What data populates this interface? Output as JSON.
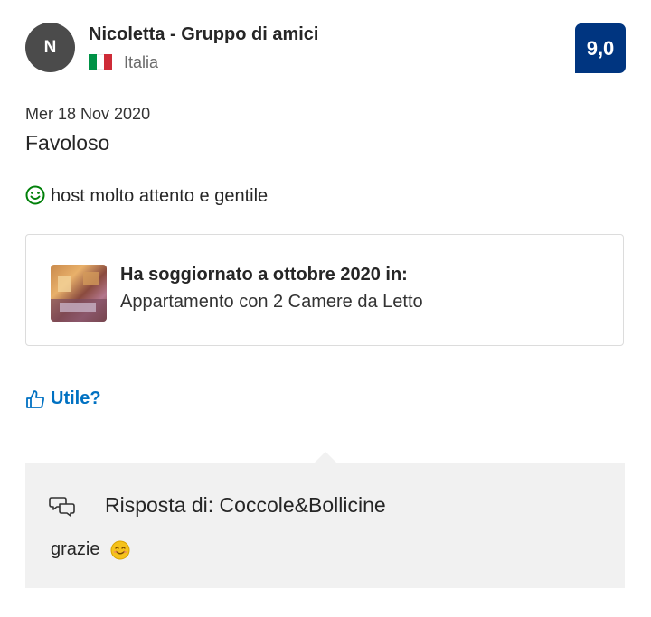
{
  "reviewer": {
    "initial": "N",
    "name": "Nicoletta - Gruppo di amici",
    "country": "Italia",
    "flag_colors": [
      "#009246",
      "#ffffff",
      "#ce2b37"
    ]
  },
  "score": "9,0",
  "review": {
    "date": "Mer 18 Nov 2020",
    "title": "Favoloso",
    "positive": "host molto attento e gentile"
  },
  "stay": {
    "heading": "Ha soggiornato a ottobre 2020 in:",
    "room": "Appartamento con 2 Camere da Letto"
  },
  "helpful_label": "Utile?",
  "reply": {
    "heading": "Risposta di: Coccole&Bollicine",
    "text": "grazie"
  },
  "colors": {
    "brand": "#003580",
    "link": "#0071c2",
    "positive": "#008009"
  }
}
